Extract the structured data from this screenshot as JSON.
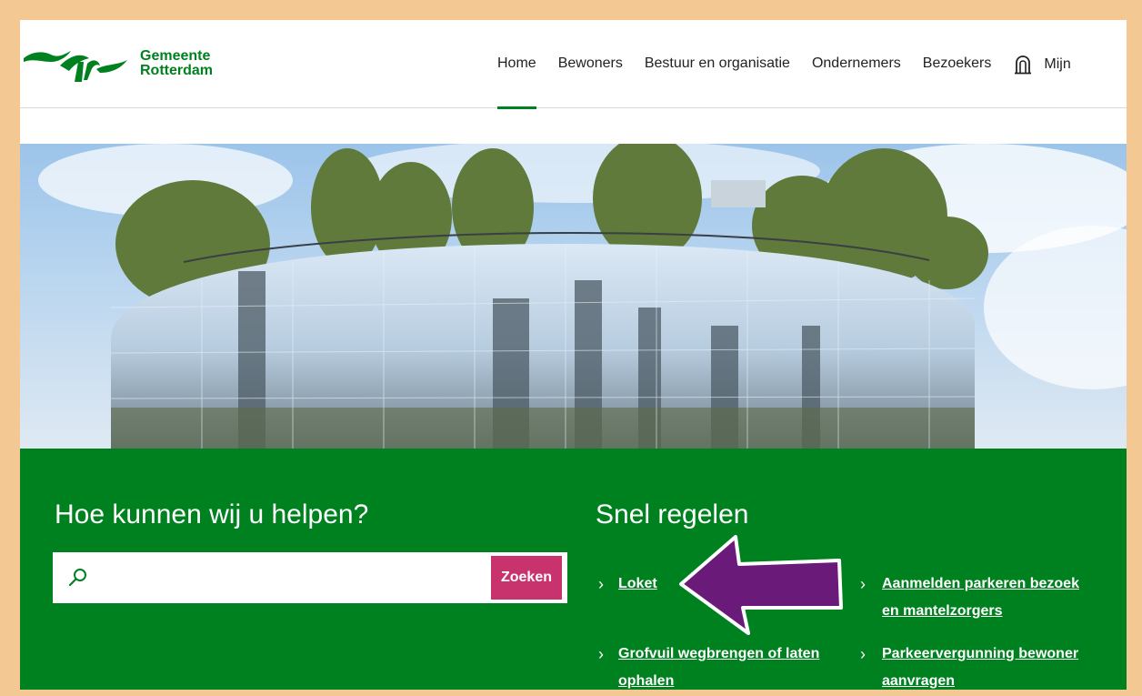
{
  "header": {
    "logo_line1": "Gemeente",
    "logo_line2": "Rotterdam",
    "nav": [
      "Home",
      "Bewoners",
      "Bestuur en organisatie",
      "Ondernemers",
      "Bezoekers"
    ],
    "mijn_label": "Mijn",
    "mijn_icon": "building-icon"
  },
  "search": {
    "title": "Hoe kunnen wij u helpen?",
    "placeholder": "",
    "button_label": "Zoeken",
    "icon": "search-icon"
  },
  "snel_regelen": {
    "title": "Snel regelen",
    "links": [
      {
        "label": "Loket"
      },
      {
        "label_line1": "Aanmelden parkeren bezoek",
        "label_line2": "en mantelzorgers"
      },
      {
        "label_line1": "Grofvuil wegbrengen of laten",
        "label_line2": "ophalen"
      },
      {
        "label_line1": "Parkeervergunning bewoner",
        "label_line2": "aanvragen"
      }
    ]
  },
  "colors": {
    "brand_green": "#00811f",
    "search_button": "#c8336e",
    "annotation_arrow": "#6a1b7a",
    "frame": "#f3c893"
  }
}
